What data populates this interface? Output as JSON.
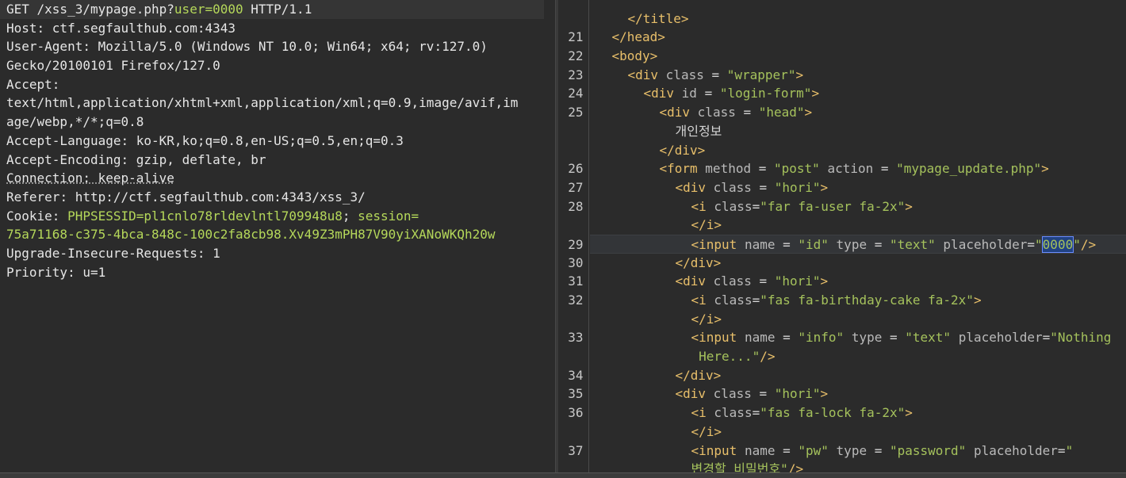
{
  "request": {
    "lines": [
      {
        "parts": [
          {
            "t": "GET /xss_3/mypage.php?",
            "c": ""
          },
          {
            "t": "user=0000",
            "c": "green"
          },
          {
            "t": " HTTP/1.1",
            "c": ""
          }
        ]
      },
      {
        "parts": [
          {
            "t": "Host",
            "c": ""
          },
          {
            "t": ": ctf.segfaulthub.com:4343",
            "c": ""
          }
        ]
      },
      {
        "parts": [
          {
            "t": "User-Agent",
            "c": ""
          },
          {
            "t": ": Mozilla/5.0 (Windows NT 10.0; Win64; x64; rv:127.0)",
            "c": ""
          }
        ]
      },
      {
        "parts": [
          {
            "t": "Gecko/20100101 Firefox/127.0",
            "c": ""
          }
        ]
      },
      {
        "parts": [
          {
            "t": "Accept",
            "c": ""
          },
          {
            "t": ":",
            "c": ""
          }
        ]
      },
      {
        "parts": [
          {
            "t": "text/html,application/xhtml+xml,application/xml;q=0.9,image/avif,im",
            "c": ""
          }
        ]
      },
      {
        "parts": [
          {
            "t": "age/webp,*/*;q=0.8",
            "c": ""
          }
        ]
      },
      {
        "parts": [
          {
            "t": "Accept-Language",
            "c": ""
          },
          {
            "t": ": ko-KR,ko;q=0.8,en-US;q=0.5,en;q=0.3",
            "c": ""
          }
        ]
      },
      {
        "parts": [
          {
            "t": "Accept-Encoding",
            "c": ""
          },
          {
            "t": ": gzip, deflate, br",
            "c": ""
          }
        ]
      },
      {
        "parts": [
          {
            "t": "Connection: keep-alive",
            "c": "underline-dotted"
          }
        ]
      },
      {
        "parts": [
          {
            "t": "Referer",
            "c": ""
          },
          {
            "t": ": http://ctf.segfaulthub.com:4343/xss_3/",
            "c": ""
          }
        ]
      },
      {
        "parts": [
          {
            "t": "Cookie",
            "c": ""
          },
          {
            "t": ": ",
            "c": ""
          },
          {
            "t": "PHPSESSID=pl1cnlo78rldevlntl709948u8",
            "c": "green"
          },
          {
            "t": "; ",
            "c": ""
          },
          {
            "t": "session=",
            "c": "green"
          }
        ]
      },
      {
        "parts": [
          {
            "t": "75a71168-c375-4bca-848c-100c2fa8cb98.Xv49Z3mPH87V90yiXANoWKQh20w",
            "c": "green"
          }
        ]
      },
      {
        "parts": [
          {
            "t": "Upgrade-Insecure-Requests",
            "c": ""
          },
          {
            "t": ": 1",
            "c": ""
          }
        ]
      },
      {
        "parts": [
          {
            "t": "Priority",
            "c": ""
          },
          {
            "t": ": u=1",
            "c": ""
          }
        ]
      }
    ]
  },
  "code": {
    "rows": [
      {
        "ln": "",
        "indent": 2,
        "parts": [
          {
            "t": "  ",
            "c": "plain"
          }
        ]
      },
      {
        "ln": "",
        "indent": 2,
        "parts": [
          {
            "t": "</title>",
            "c": "tag"
          }
        ]
      },
      {
        "ln": "21",
        "indent": 1,
        "parts": [
          {
            "t": "</head>",
            "c": "tag"
          }
        ]
      },
      {
        "ln": "22",
        "indent": 1,
        "parts": [
          {
            "t": "<body>",
            "c": "tag"
          }
        ]
      },
      {
        "ln": "23",
        "indent": 2,
        "parts": [
          {
            "t": "<div ",
            "c": "tag"
          },
          {
            "t": "class",
            "c": "attr"
          },
          {
            "t": " = ",
            "c": "plain"
          },
          {
            "t": "\"wrapper\"",
            "c": "str"
          },
          {
            "t": ">",
            "c": "tag"
          }
        ]
      },
      {
        "ln": "24",
        "indent": 3,
        "parts": [
          {
            "t": "<div ",
            "c": "tag"
          },
          {
            "t": "id",
            "c": "attr"
          },
          {
            "t": " = ",
            "c": "plain"
          },
          {
            "t": "\"login-form\"",
            "c": "str"
          },
          {
            "t": ">",
            "c": "tag"
          }
        ]
      },
      {
        "ln": "25",
        "indent": 4,
        "parts": [
          {
            "t": "<div ",
            "c": "tag"
          },
          {
            "t": "class",
            "c": "attr"
          },
          {
            "t": " = ",
            "c": "plain"
          },
          {
            "t": "\"head\"",
            "c": "str"
          },
          {
            "t": ">",
            "c": "tag"
          }
        ]
      },
      {
        "ln": "",
        "indent": 5,
        "parts": [
          {
            "t": "개인정보",
            "c": "kr"
          }
        ]
      },
      {
        "ln": "",
        "indent": 4,
        "parts": [
          {
            "t": "</div>",
            "c": "tag"
          }
        ]
      },
      {
        "ln": "26",
        "indent": 4,
        "parts": [
          {
            "t": "<form ",
            "c": "tag"
          },
          {
            "t": "method",
            "c": "attr"
          },
          {
            "t": " = ",
            "c": "plain"
          },
          {
            "t": "\"post\"",
            "c": "str"
          },
          {
            "t": " ",
            "c": "plain"
          },
          {
            "t": "action",
            "c": "attr"
          },
          {
            "t": " = ",
            "c": "plain"
          },
          {
            "t": "\"mypage_update.php\"",
            "c": "str"
          },
          {
            "t": ">",
            "c": "tag"
          }
        ]
      },
      {
        "ln": "27",
        "indent": 5,
        "parts": [
          {
            "t": "<div ",
            "c": "tag"
          },
          {
            "t": "class",
            "c": "attr"
          },
          {
            "t": " = ",
            "c": "plain"
          },
          {
            "t": "\"hori\"",
            "c": "str"
          },
          {
            "t": ">",
            "c": "tag"
          }
        ]
      },
      {
        "ln": "28",
        "indent": 6,
        "parts": [
          {
            "t": "<i ",
            "c": "tag"
          },
          {
            "t": "class",
            "c": "attr"
          },
          {
            "t": "=",
            "c": "plain"
          },
          {
            "t": "\"far fa-user fa-2x\"",
            "c": "str"
          },
          {
            "t": ">",
            "c": "tag"
          }
        ]
      },
      {
        "ln": "",
        "indent": 6,
        "parts": [
          {
            "t": "</i>",
            "c": "tag"
          }
        ]
      },
      {
        "ln": "29",
        "indent": 6,
        "hl": true,
        "parts": [
          {
            "t": "<input ",
            "c": "tag"
          },
          {
            "t": "name",
            "c": "attr"
          },
          {
            "t": " = ",
            "c": "plain"
          },
          {
            "t": "\"id\"",
            "c": "str"
          },
          {
            "t": " ",
            "c": "plain"
          },
          {
            "t": "type",
            "c": "attr"
          },
          {
            "t": " = ",
            "c": "plain"
          },
          {
            "t": "\"text\"",
            "c": "str"
          },
          {
            "t": " ",
            "c": "plain"
          },
          {
            "t": "placeholder",
            "c": "attr"
          },
          {
            "t": "=",
            "c": "plain"
          },
          {
            "t": "\"",
            "c": "str"
          },
          {
            "t": "0000",
            "c": "str sel"
          },
          {
            "t": "\"",
            "c": "str"
          },
          {
            "t": "/>",
            "c": "tag"
          }
        ]
      },
      {
        "ln": "30",
        "indent": 5,
        "parts": [
          {
            "t": "</div>",
            "c": "tag"
          }
        ]
      },
      {
        "ln": "31",
        "indent": 5,
        "parts": [
          {
            "t": "<div ",
            "c": "tag"
          },
          {
            "t": "class",
            "c": "attr"
          },
          {
            "t": " = ",
            "c": "plain"
          },
          {
            "t": "\"hori\"",
            "c": "str"
          },
          {
            "t": ">",
            "c": "tag"
          }
        ]
      },
      {
        "ln": "32",
        "indent": 6,
        "parts": [
          {
            "t": "<i ",
            "c": "tag"
          },
          {
            "t": "class",
            "c": "attr"
          },
          {
            "t": "=",
            "c": "plain"
          },
          {
            "t": "\"fas fa-birthday-cake fa-2x\"",
            "c": "str"
          },
          {
            "t": ">",
            "c": "tag"
          }
        ]
      },
      {
        "ln": "",
        "indent": 6,
        "parts": [
          {
            "t": "</i>",
            "c": "tag"
          }
        ]
      },
      {
        "ln": "33",
        "indent": 6,
        "parts": [
          {
            "t": "<input ",
            "c": "tag"
          },
          {
            "t": "name",
            "c": "attr"
          },
          {
            "t": " = ",
            "c": "plain"
          },
          {
            "t": "\"info\"",
            "c": "str"
          },
          {
            "t": " ",
            "c": "plain"
          },
          {
            "t": "type",
            "c": "attr"
          },
          {
            "t": " = ",
            "c": "plain"
          },
          {
            "t": "\"text\"",
            "c": "str"
          },
          {
            "t": " ",
            "c": "plain"
          },
          {
            "t": "placeholder",
            "c": "attr"
          },
          {
            "t": "=",
            "c": "plain"
          },
          {
            "t": "\"Nothing",
            "c": "str"
          }
        ]
      },
      {
        "ln": "",
        "indent": 6,
        "parts": [
          {
            "t": " Here...\"",
            "c": "str"
          },
          {
            "t": "/>",
            "c": "tag"
          }
        ]
      },
      {
        "ln": "34",
        "indent": 5,
        "parts": [
          {
            "t": "</div>",
            "c": "tag"
          }
        ]
      },
      {
        "ln": "35",
        "indent": 5,
        "parts": [
          {
            "t": "<div ",
            "c": "tag"
          },
          {
            "t": "class",
            "c": "attr"
          },
          {
            "t": " = ",
            "c": "plain"
          },
          {
            "t": "\"hori\"",
            "c": "str"
          },
          {
            "t": ">",
            "c": "tag"
          }
        ]
      },
      {
        "ln": "36",
        "indent": 6,
        "parts": [
          {
            "t": "<i ",
            "c": "tag"
          },
          {
            "t": "class",
            "c": "attr"
          },
          {
            "t": "=",
            "c": "plain"
          },
          {
            "t": "\"fas fa-lock fa-2x\"",
            "c": "str"
          },
          {
            "t": ">",
            "c": "tag"
          }
        ]
      },
      {
        "ln": "",
        "indent": 6,
        "parts": [
          {
            "t": "</i>",
            "c": "tag"
          }
        ]
      },
      {
        "ln": "37",
        "indent": 6,
        "parts": [
          {
            "t": "<input ",
            "c": "tag"
          },
          {
            "t": "name",
            "c": "attr"
          },
          {
            "t": " = ",
            "c": "plain"
          },
          {
            "t": "\"pw\"",
            "c": "str"
          },
          {
            "t": " ",
            "c": "plain"
          },
          {
            "t": "type",
            "c": "attr"
          },
          {
            "t": " = ",
            "c": "plain"
          },
          {
            "t": "\"password\"",
            "c": "str"
          },
          {
            "t": " ",
            "c": "plain"
          },
          {
            "t": "placeholder",
            "c": "attr"
          },
          {
            "t": "=",
            "c": "plain"
          },
          {
            "t": "\"",
            "c": "str"
          }
        ]
      },
      {
        "ln": "",
        "indent": 6,
        "parts": [
          {
            "t": "변경할 비밀번호\"",
            "c": "str"
          },
          {
            "t": "/>",
            "c": "tag"
          }
        ]
      }
    ]
  }
}
